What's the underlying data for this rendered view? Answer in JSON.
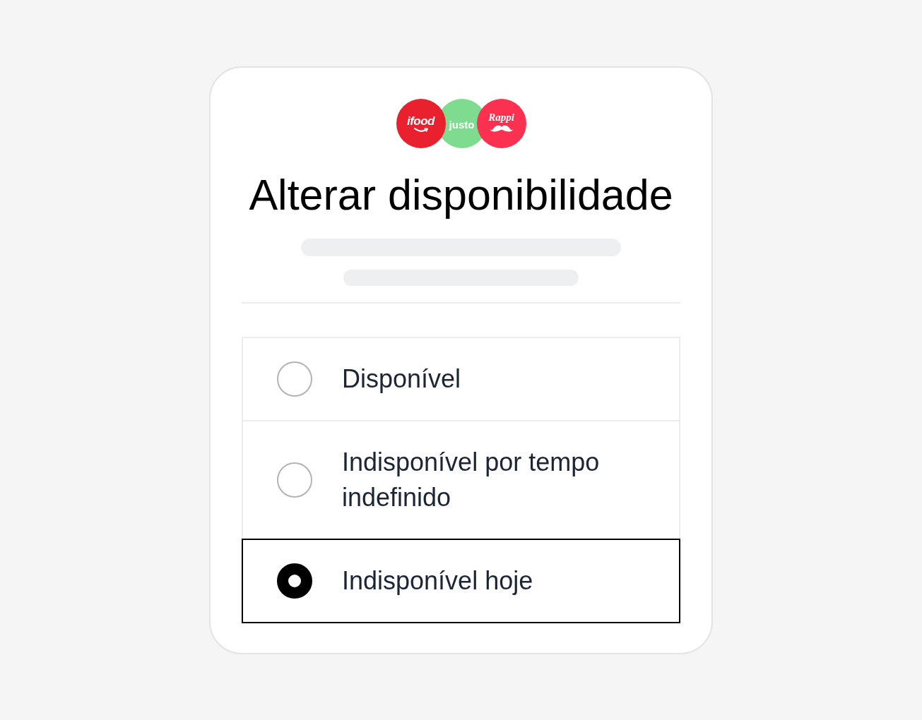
{
  "logos": [
    {
      "kind": "smile",
      "text": "ifood",
      "color": "#e9202e"
    },
    {
      "kind": "plain",
      "text": "justo",
      "color": "#7ddc8d"
    },
    {
      "kind": "mustache",
      "text": "Rappi",
      "color": "#fc3050"
    }
  ],
  "title": "Alterar disponibilidade",
  "options": [
    {
      "label": "Disponível",
      "selected": false
    },
    {
      "label": "Indisponível por tempo indefinido",
      "selected": false
    },
    {
      "label": "Indisponível hoje",
      "selected": true
    }
  ]
}
